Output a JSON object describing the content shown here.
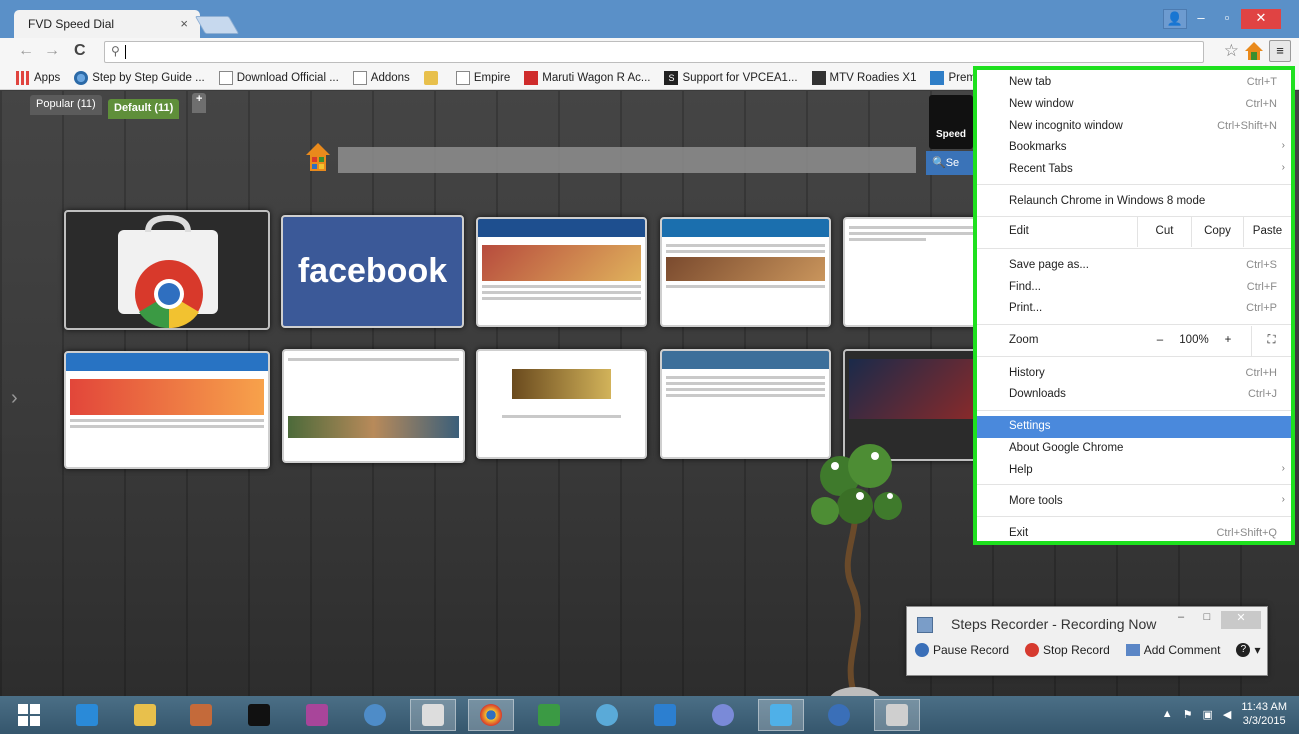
{
  "window": {
    "tab_title": "FVD Speed Dial",
    "tab_close": "×",
    "user_label": "👤",
    "min_label": "–",
    "max_label": "▫",
    "close_label": "✕"
  },
  "toolbar": {
    "back": "←",
    "forward": "→",
    "reload": "C",
    "search_icon": "⚲",
    "address_value": "",
    "star": "☆",
    "menu": "≡"
  },
  "bookmarks": [
    {
      "label": "Apps",
      "icon": "apps-icon"
    },
    {
      "label": "Step by Step Guide ...",
      "icon": "globe-icon"
    },
    {
      "label": "Download Official ...",
      "icon": "page-icon"
    },
    {
      "label": "Addons",
      "icon": "page-icon"
    },
    {
      "label": "",
      "icon": "folder-icon"
    },
    {
      "label": "Empire",
      "icon": "page-icon"
    },
    {
      "label": "Maruti Wagon R Ac...",
      "icon": "red-icon"
    },
    {
      "label": "Support for VPCEA1...",
      "icon": "s-icon"
    },
    {
      "label": "MTV Roadies X1",
      "icon": "mtv-icon"
    },
    {
      "label": "Premium",
      "icon": "v-icon"
    }
  ],
  "speeddial": {
    "popular_tab": "Popular (11)",
    "default_tab": "Default (11)",
    "add_tab": "+",
    "logo_text": "Speed",
    "search_btn": "Se",
    "left_arrow": "›",
    "facebook": "facebook"
  },
  "menu": {
    "new_tab": "New tab",
    "new_tab_sc": "Ctrl+T",
    "new_window": "New window",
    "new_window_sc": "Ctrl+N",
    "incognito": "New incognito window",
    "incognito_sc": "Ctrl+Shift+N",
    "bookmarks": "Bookmarks",
    "recent_tabs": "Recent Tabs",
    "relaunch": "Relaunch Chrome in Windows 8 mode",
    "edit": "Edit",
    "cut": "Cut",
    "copy": "Copy",
    "paste": "Paste",
    "save_page": "Save page as...",
    "save_page_sc": "Ctrl+S",
    "find": "Find...",
    "find_sc": "Ctrl+F",
    "print": "Print...",
    "print_sc": "Ctrl+P",
    "zoom": "Zoom",
    "zoom_minus": "–",
    "zoom_value": "100%",
    "zoom_plus": "+",
    "fullscreen": "⛶",
    "history": "History",
    "history_sc": "Ctrl+H",
    "downloads": "Downloads",
    "downloads_sc": "Ctrl+J",
    "settings": "Settings",
    "about": "About Google Chrome",
    "help": "Help",
    "more_tools": "More tools",
    "exit": "Exit",
    "exit_sc": "Ctrl+Shift+Q",
    "submenu_arrow": "›"
  },
  "recorder": {
    "title": "Steps Recorder - Recording Now",
    "pause": "Pause Record",
    "stop": "Stop Record",
    "add_comment": "Add Comment",
    "help": "?",
    "dropdown": "▾",
    "min": "–",
    "max": "□",
    "close": "✕"
  },
  "taskbar": {
    "time": "11:43 AM",
    "date": "3/3/2015",
    "tray_arrow": "▲"
  },
  "colors": {
    "menu_highlight": "#4a89dc",
    "menu_border": "#1ee01e",
    "titlebar": "#5a90c8"
  }
}
